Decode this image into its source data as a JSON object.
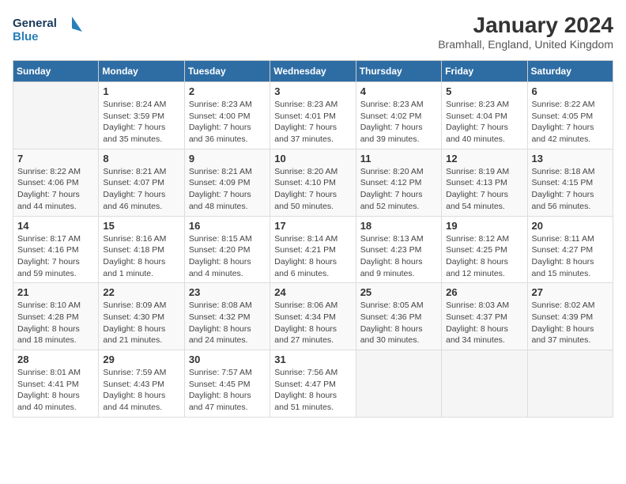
{
  "logo": {
    "line1": "General",
    "line2": "Blue"
  },
  "title": "January 2024",
  "subtitle": "Bramhall, England, United Kingdom",
  "days_header": [
    "Sunday",
    "Monday",
    "Tuesday",
    "Wednesday",
    "Thursday",
    "Friday",
    "Saturday"
  ],
  "weeks": [
    [
      {
        "num": "",
        "info": ""
      },
      {
        "num": "1",
        "info": "Sunrise: 8:24 AM\nSunset: 3:59 PM\nDaylight: 7 hours\nand 35 minutes."
      },
      {
        "num": "2",
        "info": "Sunrise: 8:23 AM\nSunset: 4:00 PM\nDaylight: 7 hours\nand 36 minutes."
      },
      {
        "num": "3",
        "info": "Sunrise: 8:23 AM\nSunset: 4:01 PM\nDaylight: 7 hours\nand 37 minutes."
      },
      {
        "num": "4",
        "info": "Sunrise: 8:23 AM\nSunset: 4:02 PM\nDaylight: 7 hours\nand 39 minutes."
      },
      {
        "num": "5",
        "info": "Sunrise: 8:23 AM\nSunset: 4:04 PM\nDaylight: 7 hours\nand 40 minutes."
      },
      {
        "num": "6",
        "info": "Sunrise: 8:22 AM\nSunset: 4:05 PM\nDaylight: 7 hours\nand 42 minutes."
      }
    ],
    [
      {
        "num": "7",
        "info": "Sunrise: 8:22 AM\nSunset: 4:06 PM\nDaylight: 7 hours\nand 44 minutes."
      },
      {
        "num": "8",
        "info": "Sunrise: 8:21 AM\nSunset: 4:07 PM\nDaylight: 7 hours\nand 46 minutes."
      },
      {
        "num": "9",
        "info": "Sunrise: 8:21 AM\nSunset: 4:09 PM\nDaylight: 7 hours\nand 48 minutes."
      },
      {
        "num": "10",
        "info": "Sunrise: 8:20 AM\nSunset: 4:10 PM\nDaylight: 7 hours\nand 50 minutes."
      },
      {
        "num": "11",
        "info": "Sunrise: 8:20 AM\nSunset: 4:12 PM\nDaylight: 7 hours\nand 52 minutes."
      },
      {
        "num": "12",
        "info": "Sunrise: 8:19 AM\nSunset: 4:13 PM\nDaylight: 7 hours\nand 54 minutes."
      },
      {
        "num": "13",
        "info": "Sunrise: 8:18 AM\nSunset: 4:15 PM\nDaylight: 7 hours\nand 56 minutes."
      }
    ],
    [
      {
        "num": "14",
        "info": "Sunrise: 8:17 AM\nSunset: 4:16 PM\nDaylight: 7 hours\nand 59 minutes."
      },
      {
        "num": "15",
        "info": "Sunrise: 8:16 AM\nSunset: 4:18 PM\nDaylight: 8 hours\nand 1 minute."
      },
      {
        "num": "16",
        "info": "Sunrise: 8:15 AM\nSunset: 4:20 PM\nDaylight: 8 hours\nand 4 minutes."
      },
      {
        "num": "17",
        "info": "Sunrise: 8:14 AM\nSunset: 4:21 PM\nDaylight: 8 hours\nand 6 minutes."
      },
      {
        "num": "18",
        "info": "Sunrise: 8:13 AM\nSunset: 4:23 PM\nDaylight: 8 hours\nand 9 minutes."
      },
      {
        "num": "19",
        "info": "Sunrise: 8:12 AM\nSunset: 4:25 PM\nDaylight: 8 hours\nand 12 minutes."
      },
      {
        "num": "20",
        "info": "Sunrise: 8:11 AM\nSunset: 4:27 PM\nDaylight: 8 hours\nand 15 minutes."
      }
    ],
    [
      {
        "num": "21",
        "info": "Sunrise: 8:10 AM\nSunset: 4:28 PM\nDaylight: 8 hours\nand 18 minutes."
      },
      {
        "num": "22",
        "info": "Sunrise: 8:09 AM\nSunset: 4:30 PM\nDaylight: 8 hours\nand 21 minutes."
      },
      {
        "num": "23",
        "info": "Sunrise: 8:08 AM\nSunset: 4:32 PM\nDaylight: 8 hours\nand 24 minutes."
      },
      {
        "num": "24",
        "info": "Sunrise: 8:06 AM\nSunset: 4:34 PM\nDaylight: 8 hours\nand 27 minutes."
      },
      {
        "num": "25",
        "info": "Sunrise: 8:05 AM\nSunset: 4:36 PM\nDaylight: 8 hours\nand 30 minutes."
      },
      {
        "num": "26",
        "info": "Sunrise: 8:03 AM\nSunset: 4:37 PM\nDaylight: 8 hours\nand 34 minutes."
      },
      {
        "num": "27",
        "info": "Sunrise: 8:02 AM\nSunset: 4:39 PM\nDaylight: 8 hours\nand 37 minutes."
      }
    ],
    [
      {
        "num": "28",
        "info": "Sunrise: 8:01 AM\nSunset: 4:41 PM\nDaylight: 8 hours\nand 40 minutes."
      },
      {
        "num": "29",
        "info": "Sunrise: 7:59 AM\nSunset: 4:43 PM\nDaylight: 8 hours\nand 44 minutes."
      },
      {
        "num": "30",
        "info": "Sunrise: 7:57 AM\nSunset: 4:45 PM\nDaylight: 8 hours\nand 47 minutes."
      },
      {
        "num": "31",
        "info": "Sunrise: 7:56 AM\nSunset: 4:47 PM\nDaylight: 8 hours\nand 51 minutes."
      },
      {
        "num": "",
        "info": ""
      },
      {
        "num": "",
        "info": ""
      },
      {
        "num": "",
        "info": ""
      }
    ]
  ]
}
